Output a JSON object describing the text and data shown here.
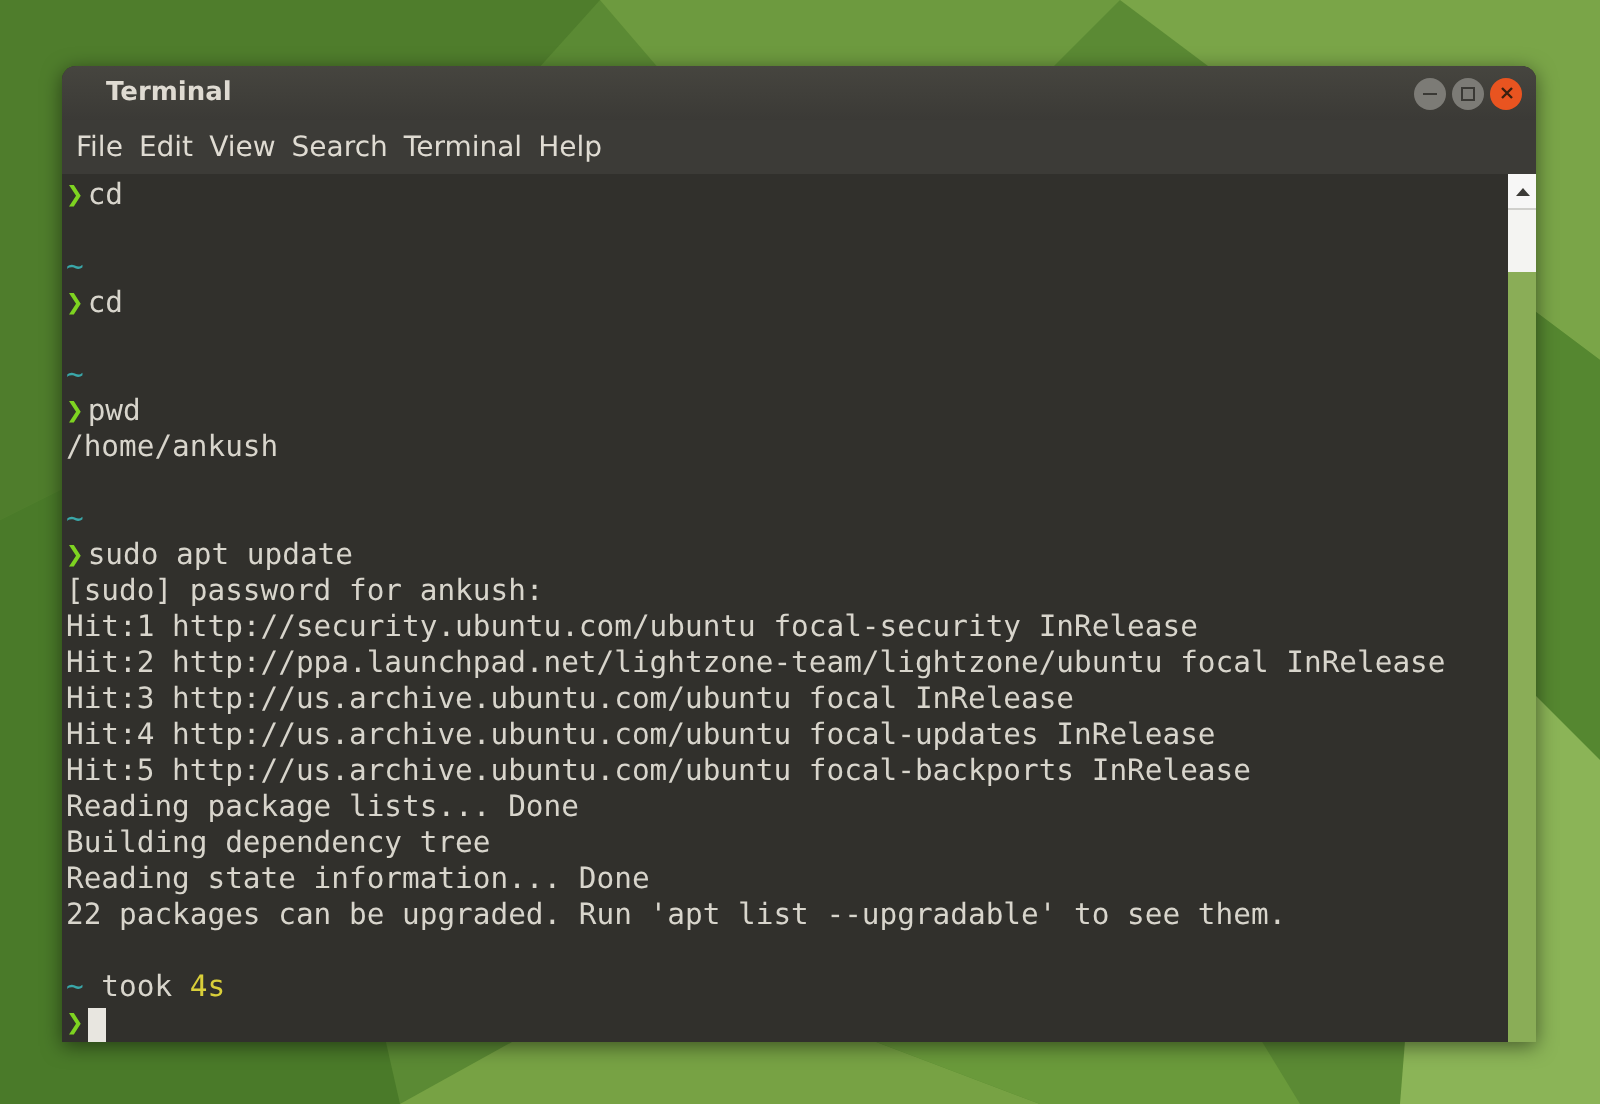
{
  "window": {
    "title": "Terminal"
  },
  "menu": [
    "File",
    "Edit",
    "View",
    "Search",
    "Terminal",
    "Help"
  ],
  "terminal_lines": [
    {
      "kind": "prompt",
      "symbol": "❯",
      "command": "cd"
    },
    {
      "kind": "blank"
    },
    {
      "kind": "cwd",
      "path": "~"
    },
    {
      "kind": "prompt",
      "symbol": "❯",
      "command": "cd"
    },
    {
      "kind": "blank"
    },
    {
      "kind": "cwd",
      "path": "~"
    },
    {
      "kind": "prompt",
      "symbol": "❯",
      "command": "pwd"
    },
    {
      "kind": "output",
      "text": "/home/ankush"
    },
    {
      "kind": "blank"
    },
    {
      "kind": "cwd",
      "path": "~"
    },
    {
      "kind": "prompt",
      "symbol": "❯",
      "command": "sudo apt update"
    },
    {
      "kind": "output",
      "text": "[sudo] password for ankush:"
    },
    {
      "kind": "output",
      "text": "Hit:1 http://security.ubuntu.com/ubuntu focal-security InRelease"
    },
    {
      "kind": "output",
      "text": "Hit:2 http://ppa.launchpad.net/lightzone-team/lightzone/ubuntu focal InRelease"
    },
    {
      "kind": "output",
      "text": "Hit:3 http://us.archive.ubuntu.com/ubuntu focal InRelease"
    },
    {
      "kind": "output",
      "text": "Hit:4 http://us.archive.ubuntu.com/ubuntu focal-updates InRelease"
    },
    {
      "kind": "output",
      "text": "Hit:5 http://us.archive.ubuntu.com/ubuntu focal-backports InRelease"
    },
    {
      "kind": "output",
      "text": "Reading package lists... Done"
    },
    {
      "kind": "output",
      "text": "Building dependency tree"
    },
    {
      "kind": "output",
      "text": "Reading state information... Done"
    },
    {
      "kind": "output",
      "text": "22 packages can be upgraded. Run 'apt list --upgradable' to see them."
    },
    {
      "kind": "blank"
    },
    {
      "kind": "cwd",
      "path": "~",
      "took": "took",
      "duration": "4s"
    },
    {
      "kind": "prompt",
      "symbol": "❯",
      "cursor": true
    }
  ]
}
